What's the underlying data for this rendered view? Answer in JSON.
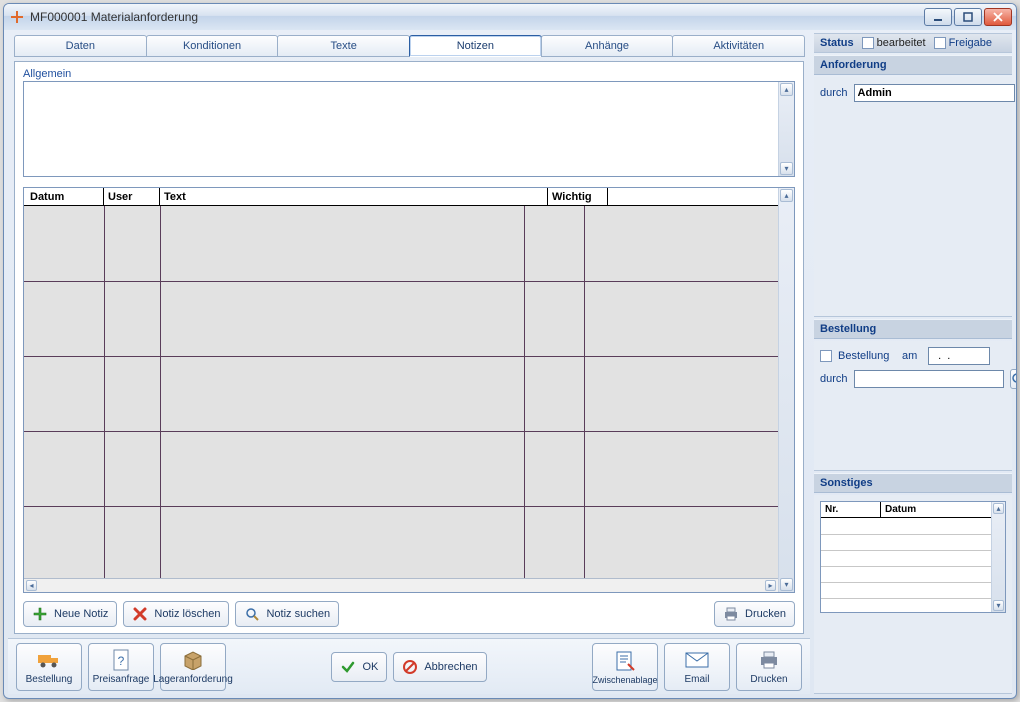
{
  "window": {
    "title": "MF000001 Materialanforderung"
  },
  "tabs": [
    "Daten",
    "Konditionen",
    "Texte",
    "Notizen",
    "Anhänge",
    "Aktivitäten"
  ],
  "active_tab": 3,
  "notes": {
    "general_label": "Allgemein",
    "columns": [
      "Datum",
      "User",
      "Text",
      "Wichtig"
    ]
  },
  "note_actions": {
    "new": "Neue Notiz",
    "delete": "Notiz löschen",
    "search": "Notiz suchen",
    "print": "Drucken"
  },
  "bottom": {
    "order": "Bestellung",
    "inquiry": "Preisanfrage",
    "stockreq": "Lageranforderung",
    "ok": "OK",
    "cancel": "Abbrechen",
    "clipboard": "Zwischenablage",
    "email": "Email",
    "print": "Drucken"
  },
  "side": {
    "status_label": "Status",
    "bearbeitet": "bearbeitet",
    "freigabe": "Freigabe",
    "anforderung": "Anforderung",
    "durch": "durch",
    "admin": "Admin",
    "bestellung_sect": "Bestellung",
    "bestellung_chk": "Bestellung",
    "am": "am",
    "date_placeholder": "  .  .",
    "durch2": "durch",
    "sonstiges": "Sonstiges",
    "mini_cols": [
      "Nr.",
      "Datum"
    ]
  }
}
